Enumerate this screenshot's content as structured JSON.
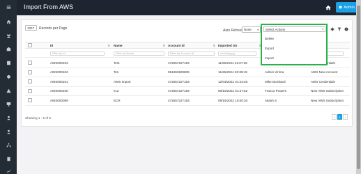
{
  "sidebar": {
    "icons": [
      "menu-icon",
      "dashboard-icon",
      "people-icon",
      "building-icon",
      "list-icon",
      "security-icon",
      "alert-icon",
      "monitor-icon",
      "user-icon",
      "user-shield-icon",
      "network-icon",
      "book-icon",
      "chart-icon"
    ]
  },
  "header": {
    "title": "Import From AWS",
    "admin_label": "Admin"
  },
  "toolbar": {
    "records_per_page_value": "100",
    "records_per_page_label": "Records per Page",
    "auto_refresh_label": "Auto Refresh",
    "auto_refresh_value": "None",
    "actions_placeholder": "Select Actions",
    "actions_options": [
      "Delete",
      "Export",
      "Import"
    ]
  },
  "table": {
    "columns": [
      "",
      "Id",
      "Name",
      "Account Id",
      "Imported On",
      "",
      ""
    ],
    "filters": [
      "",
      "Filter by Id",
      "Filter by Name",
      "Filter by Account Id",
      "mm/dd/yyyy",
      "",
      ""
    ],
    "rows": [
      [
        "",
        "AWS000103",
        "Test",
        "472657227193",
        "11/25/2024 21:07:25",
        "Franco Powers",
        "AWS Credentials"
      ],
      [
        "",
        "AWS000102",
        "Tes",
        "061363929609",
        "11/25/2024 20:38:19",
        "Admin Virima",
        "AWS New Account"
      ],
      [
        "",
        "AWS000101",
        "AWS Import",
        "472657227193",
        "12/03/2022 01:43:36",
        "Mike Bombard",
        "AWS Credentials"
      ],
      [
        "",
        "AWS000100",
        "ec2",
        "472657227193",
        "09/16/2022 01:37:52",
        "Franco Powers",
        "New AWS Subscription"
      ],
      [
        "",
        "AWS000099",
        "ECR",
        "472657227193",
        "09/16/2022 10:00:30",
        "Akash S",
        "New AWS Subscription"
      ]
    ]
  },
  "footer": {
    "showing_text": "Showing 1 - 5 of 5",
    "current_page": "1"
  },
  "colors": {
    "sidebar": "#232b35",
    "header": "#1e2530",
    "accent": "#1aa0e6",
    "highlight_border": "#27b34a"
  }
}
